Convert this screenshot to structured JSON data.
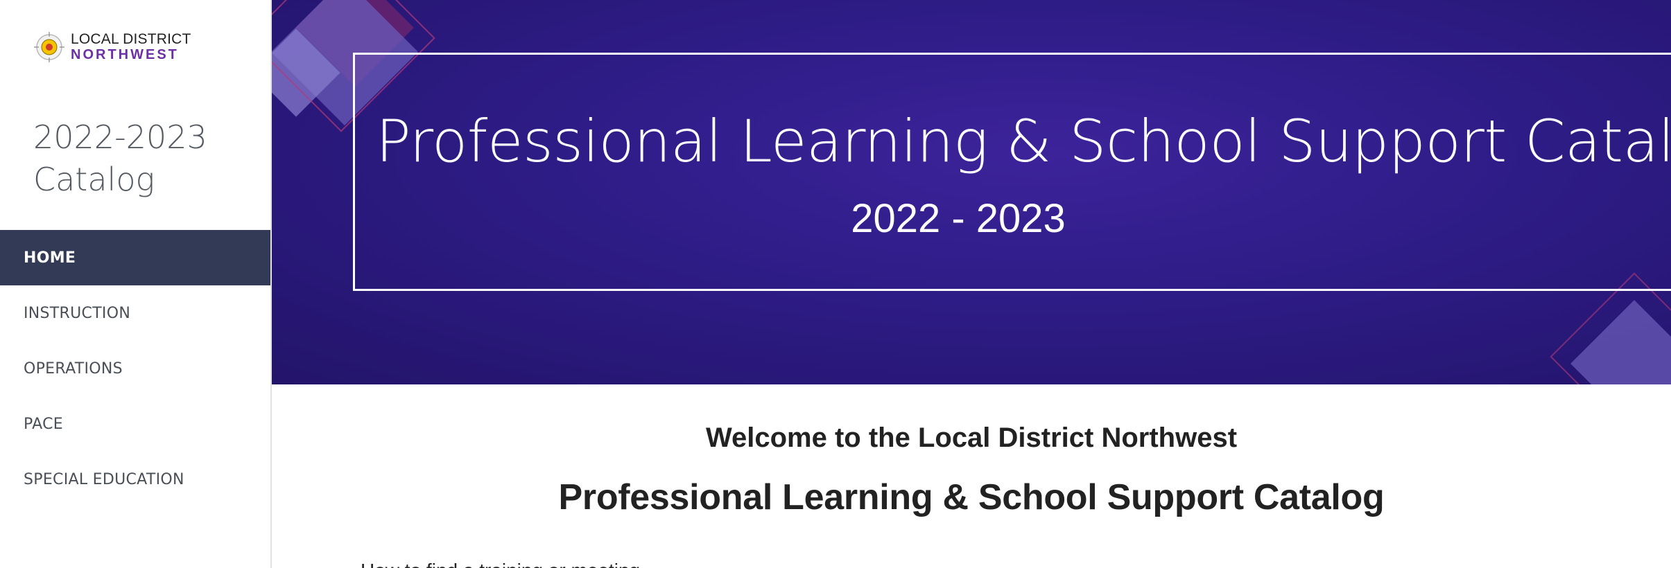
{
  "sidebar": {
    "logo": {
      "line1": "LOCAL DISTRICT",
      "line2": "NORTHWEST",
      "icon": "district-seal-icon"
    },
    "catalog_title_line1": "2022-2023",
    "catalog_title_line2": "Catalog",
    "nav": [
      {
        "label": "HOME",
        "active": true
      },
      {
        "label": "INSTRUCTION",
        "active": false
      },
      {
        "label": "OPERATIONS",
        "active": false
      },
      {
        "label": "PACE",
        "active": false
      },
      {
        "label": "SPECIAL EDUCATION",
        "active": false
      }
    ]
  },
  "hero": {
    "title": "Professional Learning & School Support Catalog",
    "year": "2022 - 2023"
  },
  "main": {
    "welcome": "Welcome to the Local District Northwest",
    "title": "Professional Learning & School Support Catalog",
    "partial_text": "How to find a training or meeting"
  },
  "colors": {
    "nav_active_bg": "#333a55",
    "hero_bg": "#2e1c86",
    "brand_purple": "#6b2fa6"
  }
}
